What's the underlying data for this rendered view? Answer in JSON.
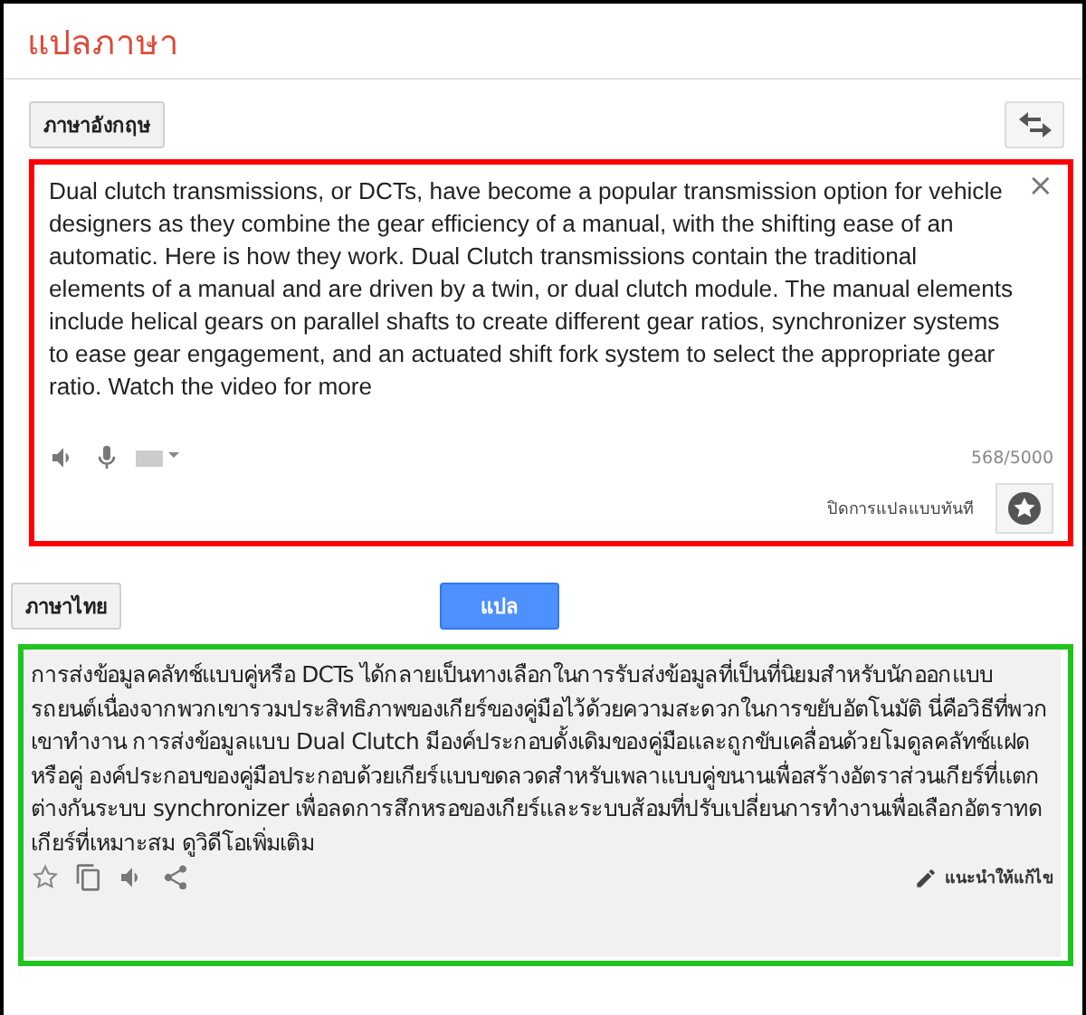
{
  "header": {
    "title": "แปลภาษา"
  },
  "source": {
    "language_button": "ภาษาอังกฤษ",
    "text": "Dual clutch transmissions, or DCTs, have become a popular transmission option for vehicle designers as they combine the gear efficiency of a manual, with the shifting ease of an automatic. Here is how they work. Dual Clutch transmissions contain the traditional elements of a manual and are driven by a twin, or dual clutch module. The manual elements include helical gears on parallel shafts to create different gear ratios, synchronizer systems to ease gear engagement, and an actuated shift fork system to select the appropriate gear ratio. Watch the video for more",
    "clear": "×",
    "char_count": "568/5000",
    "instant_toggle": "ปิดการแปลแบบทันที"
  },
  "target": {
    "language_button": "ภาษาไทย",
    "translate_button": "แปล",
    "text": "การส่งข้อมูลคลัทช์แบบคู่หรือ DCTs ได้กลายเป็นทางเลือกในการรับส่งข้อมูลที่เป็นที่นิยมสำหรับนักออกแบบรถยนต์เนื่องจากพวกเขารวมประสิทธิภาพของเกียร์ของคู่มือไว้ด้วยความสะดวกในการขยับอัตโนมัติ นี่คือวิธีที่พวกเขาทำงาน การส่งข้อมูลแบบ Dual Clutch มีองค์ประกอบดั้งเดิมของคู่มือและถูกขับเคลื่อนด้วยโมดูลคลัทช์แฝดหรือคู่ องค์ประกอบของคู่มือประกอบด้วยเกียร์แบบขดลวดสำหรับเพลาแบบคู่ขนานเพื่อสร้างอัตราส่วนเกียร์ที่แตกต่างกันระบบ synchronizer เพื่อลดการสึกหรอของเกียร์และระบบส้อมที่ปรับเปลี่ยนการทำงานเพื่อเลือกอัตราทดเกียร์ที่เหมาะสม ดูวิดีโอเพิ่มเติม",
    "suggest_edit": "แนะนำให้แก้ไข"
  }
}
